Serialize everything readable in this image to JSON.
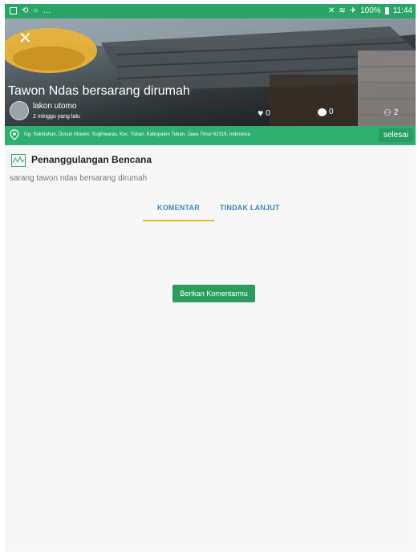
{
  "status_bar": {
    "battery": "100%",
    "time": "11:44"
  },
  "report": {
    "title": "Tawon Ndas bersarang dirumah",
    "user_name": "lakon utomo",
    "posted_time": "2 minggu yang lalu",
    "likes": "0",
    "comments": "0",
    "followers": "2",
    "address": "Gg. Sekolahan, Dusun Miawor, Sugihwaras, Kec. Tuban, Kabupaten Tuban, Jawa Timur 62319, Indonesia",
    "status_label": "selesai",
    "category": "Penanggulangan Bencana",
    "description": "sarang tawon ndas bersarang dirumah"
  },
  "tabs": [
    {
      "label": "KOMENTAR",
      "active": true
    },
    {
      "label": "TINDAK LANJUT",
      "active": false
    }
  ],
  "comment_button": "Berikan Komentarmu",
  "colors": {
    "primary_green": "#2aa56a",
    "tab_blue": "#3a8bbf",
    "tab_underline": "#e9b53a",
    "button_green": "#2a9c5e"
  },
  "icons": [
    "close-icon",
    "heart-icon",
    "comment-icon",
    "followers-icon",
    "location-pin-icon",
    "category-icon"
  ]
}
